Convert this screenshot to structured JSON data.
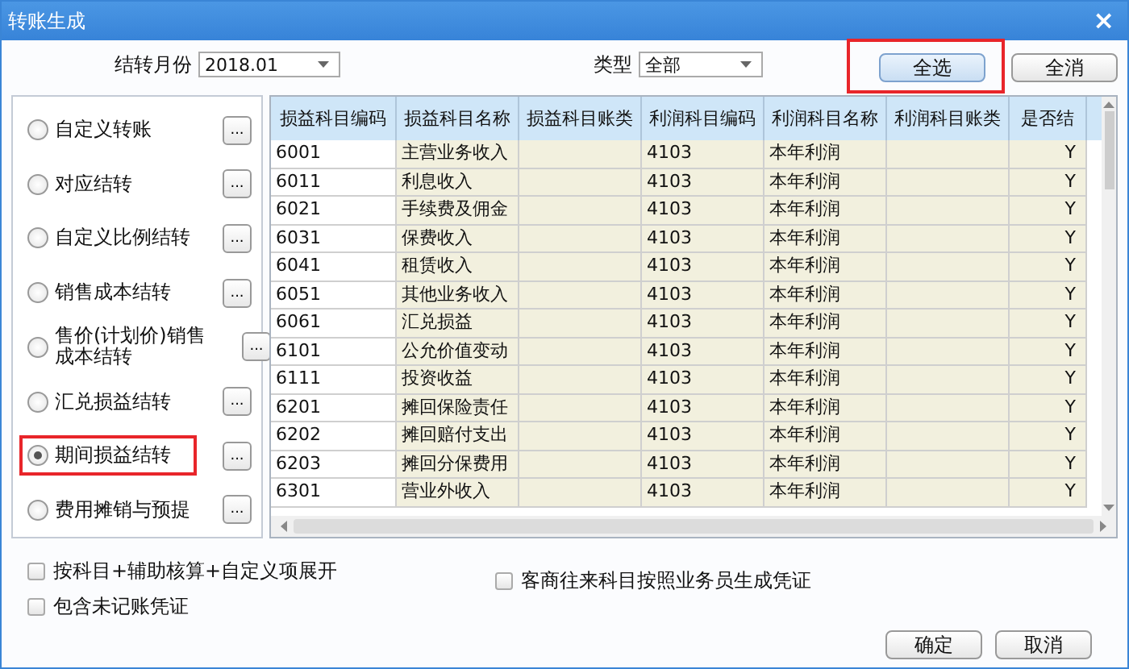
{
  "window": {
    "title": "转账生成",
    "close": "×"
  },
  "period": {
    "label": "结转月份",
    "value": "2018.01"
  },
  "type": {
    "label": "类型",
    "value": "全部"
  },
  "top_buttons": [
    {
      "label": "全选",
      "highlighted": true
    },
    {
      "label": "全消",
      "highlighted": false
    }
  ],
  "transfer_types": [
    {
      "label": "自定义转账",
      "selected": false,
      "highlighted": false,
      "more": "..."
    },
    {
      "label": "对应结转",
      "selected": false,
      "highlighted": false,
      "more": "..."
    },
    {
      "label": "自定义比例结转",
      "selected": false,
      "highlighted": false,
      "more": "..."
    },
    {
      "label": "销售成本结转",
      "selected": false,
      "highlighted": false,
      "more": "..."
    },
    {
      "label": "售价(计划价)销售成本结转",
      "selected": false,
      "highlighted": false,
      "more": "..."
    },
    {
      "label": "汇兑损益结转",
      "selected": false,
      "highlighted": false,
      "more": "..."
    },
    {
      "label": "期间损益结转",
      "selected": true,
      "highlighted": true,
      "more": "..."
    },
    {
      "label": "费用摊销与预提",
      "selected": false,
      "highlighted": false,
      "more": "..."
    }
  ],
  "table": {
    "columns": [
      "损益科目编码",
      "损益科目名称",
      "损益科目账类",
      "利润科目编码",
      "利润科目名称",
      "利润科目账类",
      "是否结"
    ],
    "rows": [
      [
        "6001",
        "主营业务收入",
        "",
        "4103",
        "本年利润",
        "",
        "Y"
      ],
      [
        "6011",
        "利息收入",
        "",
        "4103",
        "本年利润",
        "",
        "Y"
      ],
      [
        "6021",
        "手续费及佣金",
        "",
        "4103",
        "本年利润",
        "",
        "Y"
      ],
      [
        "6031",
        "保费收入",
        "",
        "4103",
        "本年利润",
        "",
        "Y"
      ],
      [
        "6041",
        "租赁收入",
        "",
        "4103",
        "本年利润",
        "",
        "Y"
      ],
      [
        "6051",
        "其他业务收入",
        "",
        "4103",
        "本年利润",
        "",
        "Y"
      ],
      [
        "6061",
        "汇兑损益",
        "",
        "4103",
        "本年利润",
        "",
        "Y"
      ],
      [
        "6101",
        "公允价值变动",
        "",
        "4103",
        "本年利润",
        "",
        "Y"
      ],
      [
        "6111",
        "投资收益",
        "",
        "4103",
        "本年利润",
        "",
        "Y"
      ],
      [
        "6201",
        "摊回保险责任",
        "",
        "4103",
        "本年利润",
        "",
        "Y"
      ],
      [
        "6202",
        "摊回赔付支出",
        "",
        "4103",
        "本年利润",
        "",
        "Y"
      ],
      [
        "6203",
        "摊回分保费用",
        "",
        "4103",
        "本年利润",
        "",
        "Y"
      ],
      [
        "6301",
        "营业外收入",
        "",
        "4103",
        "本年利润",
        "",
        "Y"
      ]
    ]
  },
  "options_left": [
    {
      "label": "按科目+辅助核算+自定义项展开",
      "checked": false
    },
    {
      "label": "包含未记账凭证",
      "checked": false
    }
  ],
  "options_right": [
    {
      "label": "客商往来科目按照业务员生成凭证",
      "checked": false
    }
  ],
  "buttons": [
    "确定",
    "取消"
  ]
}
